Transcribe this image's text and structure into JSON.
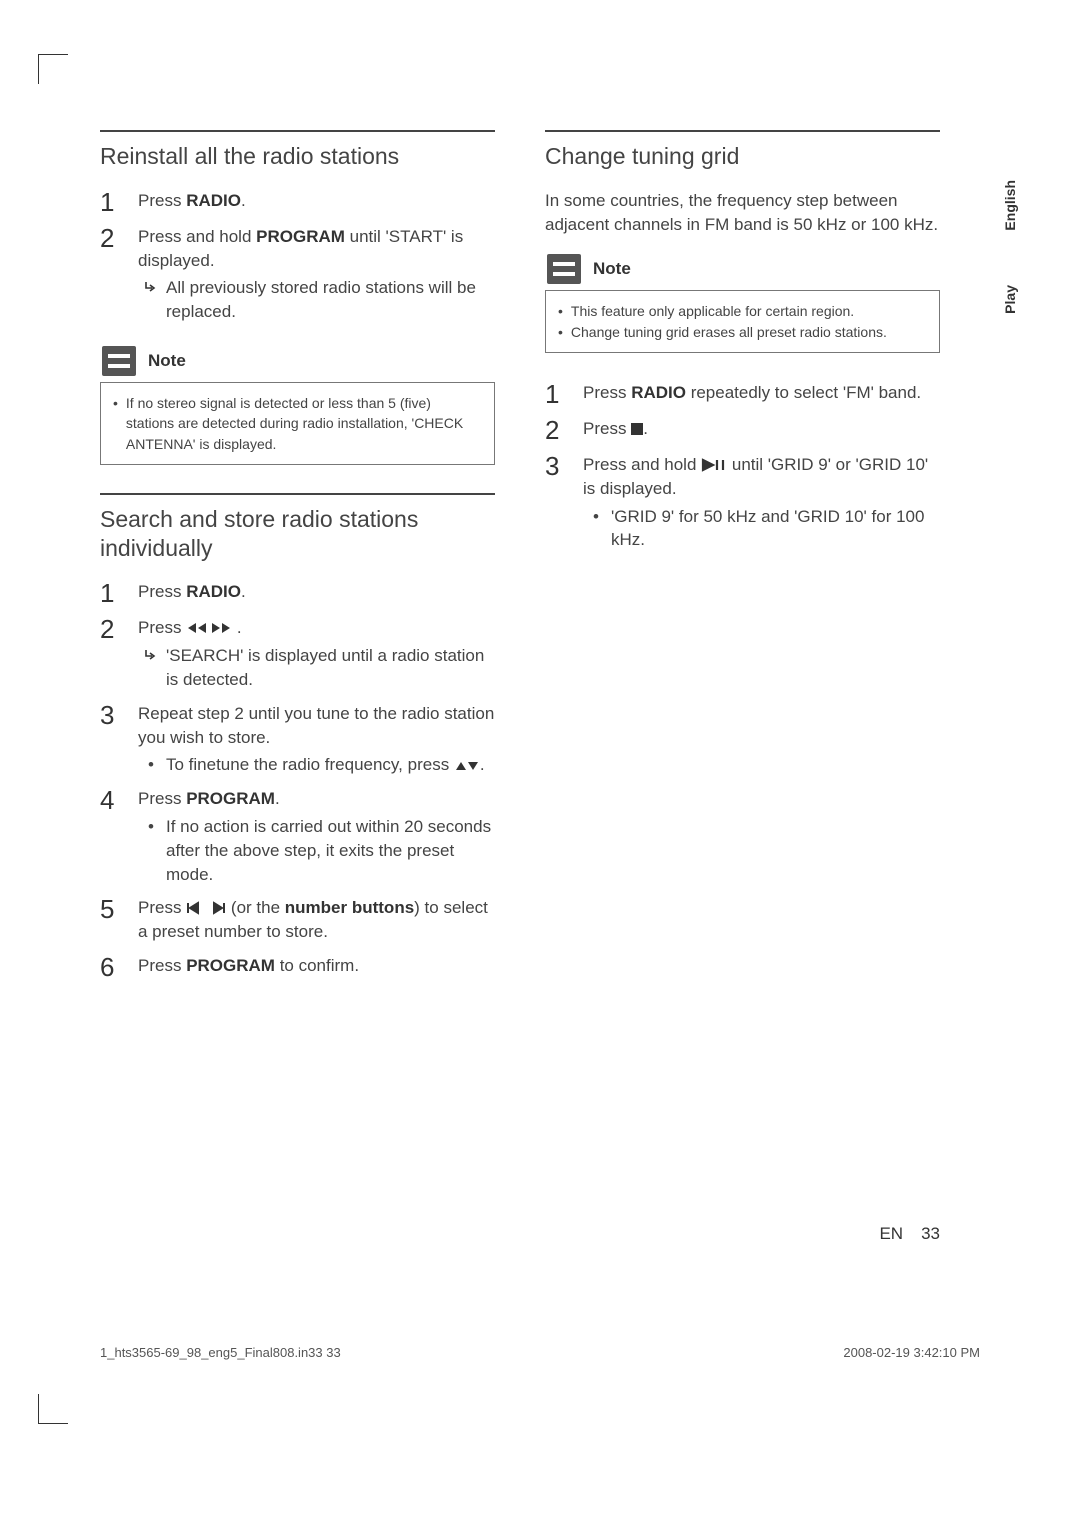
{
  "left": {
    "section1": {
      "title": "Reinstall all the radio stations",
      "steps": [
        {
          "pre": "Press ",
          "bold": "RADIO",
          "post": "."
        },
        {
          "pre": "Press and hold ",
          "bold": "PROGRAM",
          "post": " until 'START' is displayed.",
          "sub_arrow": "All previously stored radio stations will be replaced."
        }
      ],
      "note_label": "Note",
      "note_items": [
        "If no stereo signal is detected or less than 5 (five) stations are detected during radio installation, 'CHECK ANTENNA' is displayed."
      ]
    },
    "section2": {
      "title": "Search and store radio stations individually",
      "steps": [
        {
          "pre": "Press ",
          "bold": "RADIO",
          "post": "."
        },
        {
          "pre": "Press ",
          "icon": "rew-ff",
          "post": ".",
          "sub_arrow": "'SEARCH' is displayed until a radio station is detected."
        },
        {
          "plain": "Repeat step 2 until you tune to the radio station you wish to store.",
          "sub_bullet_pre": "To finetune the radio frequency, press ",
          "sub_bullet_icon": "up-down",
          "sub_bullet_post": "."
        },
        {
          "pre": "Press ",
          "bold": "PROGRAM",
          "post": ".",
          "sub_bullet_plain": "If no action is carried out within 20 seconds after the above step, it exits the preset mode."
        },
        {
          "pre": "Press ",
          "icon": "prev-next",
          "mid": " (or the ",
          "bold": "number buttons",
          "post": ") to select a preset number to store."
        },
        {
          "pre": "Press ",
          "bold": "PROGRAM",
          "post": " to confirm."
        }
      ]
    }
  },
  "right": {
    "section1": {
      "title": "Change tuning grid",
      "intro": "In some countries, the frequency step between adjacent channels in FM band is 50 kHz or 100 kHz.",
      "note_label": "Note",
      "note_items": [
        "This feature only applicable for certain region.",
        "Change tuning grid erases all preset radio stations."
      ],
      "steps": [
        {
          "pre": "Press ",
          "bold": "RADIO",
          "post": " repeatedly to select 'FM' band."
        },
        {
          "pre": "Press ",
          "icon": "stop",
          "post": "."
        },
        {
          "pre": "Press and hold ",
          "icon": "play-pause",
          "post": " until 'GRID 9' or 'GRID 10' is displayed.",
          "sub_bullet_plain": "'GRID 9' for 50 kHz and 'GRID 10' for 100 kHz."
        }
      ]
    }
  },
  "tabs": {
    "t1": "English",
    "t2": "Play"
  },
  "footer": {
    "lang": "EN",
    "page": "33",
    "file": "1_hts3565-69_98_eng5_Final808.in33   33",
    "time": "2008-02-19   3:42:10 PM"
  }
}
